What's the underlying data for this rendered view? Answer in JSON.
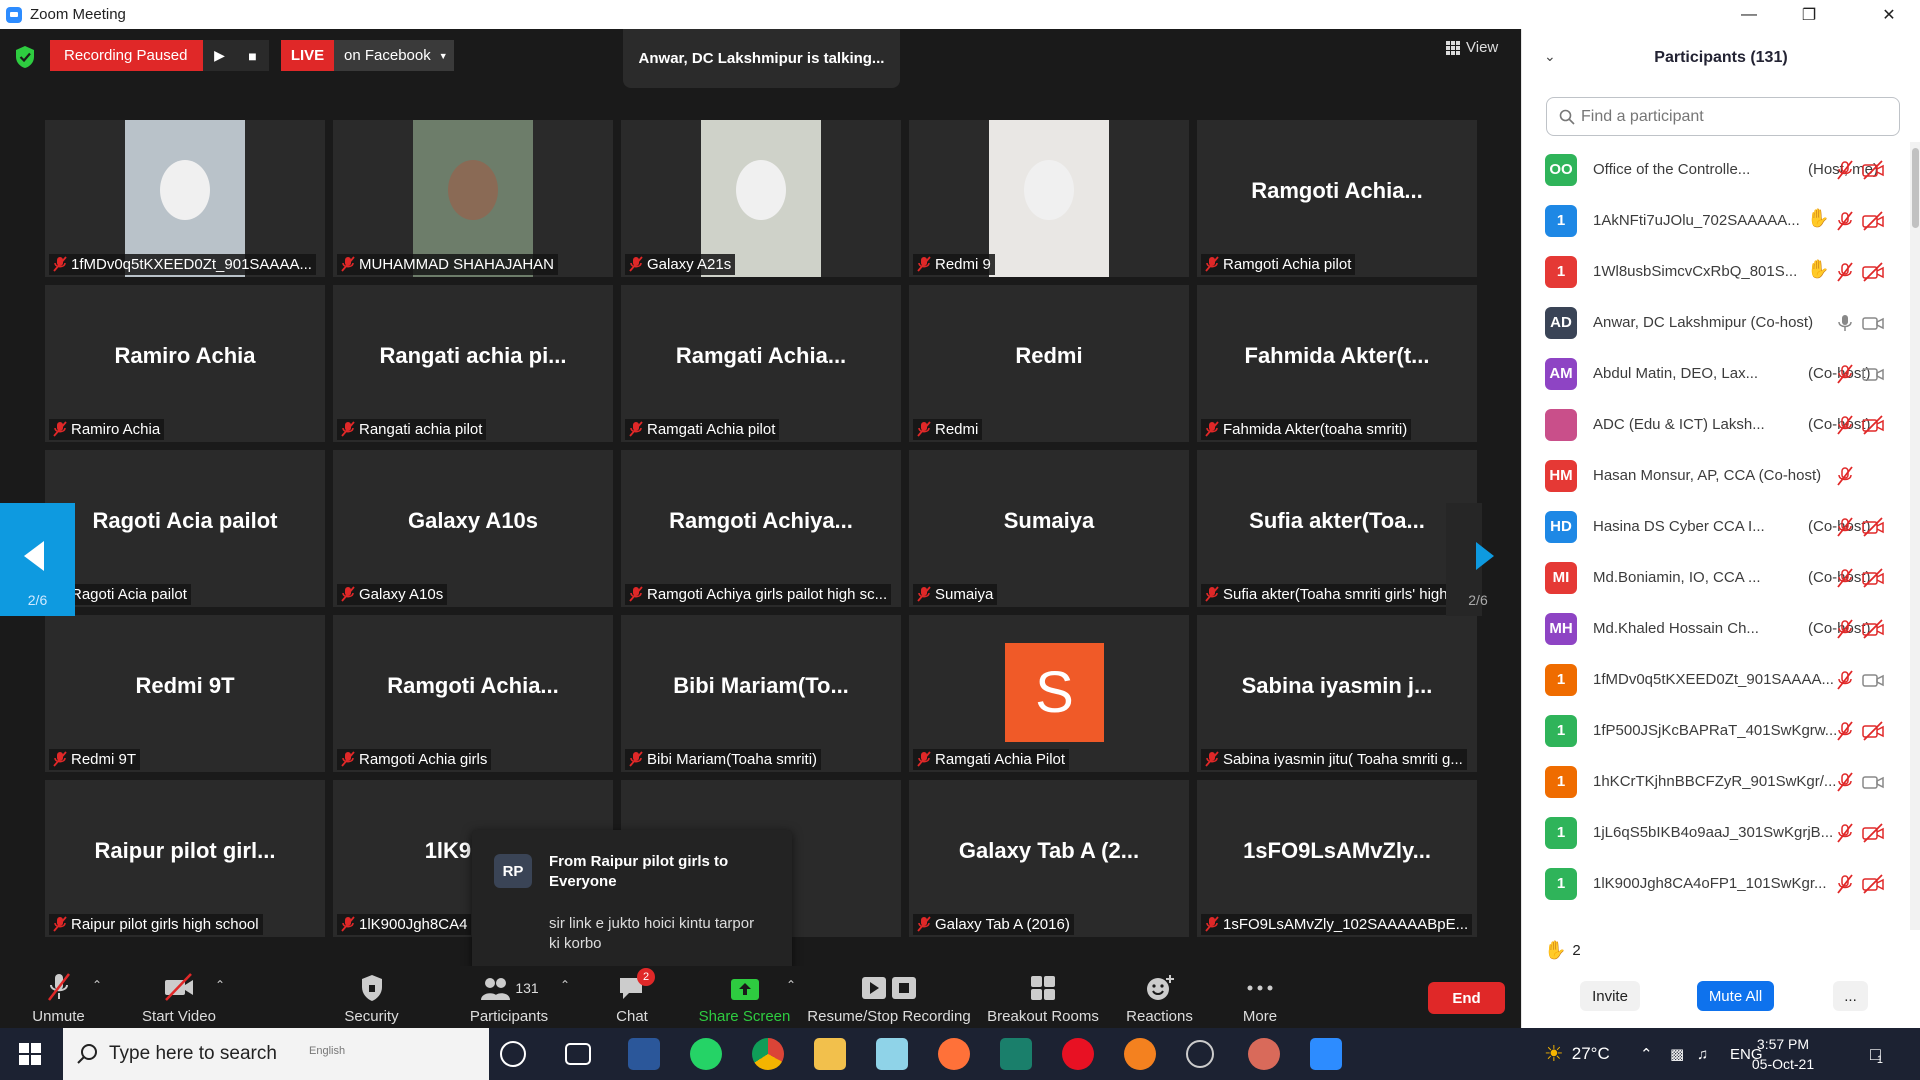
{
  "window": {
    "title": "Zoom Meeting"
  },
  "topbar": {
    "recording_label": "Recording Paused",
    "live_label": "LIVE",
    "live_target": "on Facebook",
    "talking_text": "Anwar, DC Lakshmipur is talking...",
    "view_label": "View"
  },
  "pager": {
    "left_page": "2/6",
    "right_page": "2/6"
  },
  "tiles": [
    {
      "big": "",
      "label": "1fMDv0q5tKXEED0Zt_901SAAAA..."
    },
    {
      "big": "",
      "label": "MUHAMMAD SHAHAJAHAN"
    },
    {
      "big": "",
      "label": "Galaxy A21s"
    },
    {
      "big": "",
      "label": "Redmi 9"
    },
    {
      "big": "Ramgoti  Achia...",
      "label": "Ramgoti Achia pilot"
    },
    {
      "big": "Ramiro Achia",
      "label": "Ramiro Achia"
    },
    {
      "big": "Rangati  achia  pi...",
      "label": "Rangati achia pilot"
    },
    {
      "big": "Ramgati   Achia...",
      "label": "Ramgati  Achia pilot"
    },
    {
      "big": "Redmi",
      "label": "Redmi"
    },
    {
      "big": "Fahmida  Akter(t...",
      "label": "Fahmida Akter(toaha smriti)"
    },
    {
      "big": "Ragoti Acia pailot",
      "label": "Ragoti Acia pailot"
    },
    {
      "big": "Galaxy A10s",
      "label": "Galaxy A10s"
    },
    {
      "big": "Ramgoti  Achiya...",
      "label": "Ramgoti Achiya girls pailot high sc..."
    },
    {
      "big": "Sumaiya",
      "label": "Sumaiya"
    },
    {
      "big": "Sufia  akter(Toa...",
      "label": "Sufia akter(Toaha smriti girls' high..."
    },
    {
      "big": "Redmi 9T",
      "label": "Redmi 9T"
    },
    {
      "big": "Ramgoti  Achia...",
      "label": "Ramgoti Achia girls"
    },
    {
      "big": "Bibi  Mariam(To...",
      "label": "Bibi Mariam(Toaha smriti)"
    },
    {
      "big": "S",
      "label": "Ramgati Achia Pilot"
    },
    {
      "big": "Sabina  iyasmin  j...",
      "label": "Sabina iyasmin jitu( Toaha smriti g..."
    },
    {
      "big": "Raipur  pilot  girl...",
      "label": "Raipur pilot girls high school"
    },
    {
      "big": "1lK900Jg",
      "label": "1lK900Jgh8CA4"
    },
    {
      "big": "chia...",
      "label": ""
    },
    {
      "big": "Galaxy  Tab  A  (2...",
      "label": "Galaxy Tab A (2016)"
    },
    {
      "big": "1sFO9LsAMvZly...",
      "label": "1sFO9LsAMvZly_102SAAAAABpE..."
    }
  ],
  "chat_popup": {
    "avatar": "RP",
    "from": "From Raipur pilot girls to Everyone",
    "message": "sir link e jukto hoici kintu tarpor ki korbo"
  },
  "toolbar": {
    "unmute": "Unmute",
    "start_video": "Start Video",
    "security": "Security",
    "participants": "Participants",
    "participants_count": "131",
    "chat": "Chat",
    "chat_badge": "2",
    "share_screen": "Share Screen",
    "recording": "Resume/Stop Recording",
    "breakout": "Breakout Rooms",
    "reactions": "Reactions",
    "more": "More",
    "end": "End"
  },
  "panel": {
    "title": "Participants (131)",
    "search_placeholder": "Find a participant",
    "participants": [
      {
        "av": "OO",
        "color": "#2fb45a",
        "name": "Office of the Controlle...",
        "role": "(Host, me)",
        "mic": "muted",
        "cam": "off"
      },
      {
        "av": "1",
        "color": "#1e88e5",
        "name": "1AkNFti7uJOlu_702SAAAAA...",
        "role": "",
        "hand": true,
        "mic": "muted",
        "cam": "off"
      },
      {
        "av": "1",
        "color": "#e53935",
        "name": "1Wl8usbSimcvCxRbQ_801S...",
        "role": "",
        "hand": true,
        "mic": "muted",
        "cam": "off"
      },
      {
        "av": "AD",
        "color": "#3a4456",
        "name": "Anwar, DC Lakshmipur (Co-host)",
        "role": "",
        "mic": "on",
        "cam": "on-gray"
      },
      {
        "av": "AM",
        "color": "#8e44c4",
        "name": "Abdul Matin, DEO, Lax...",
        "role": "(Co-host)",
        "mic": "muted",
        "cam": "on-gray"
      },
      {
        "av": "",
        "color": "#c94f8a",
        "name": "ADC (Edu & ICT) Laksh...",
        "role": "(Co-host)",
        "mic": "muted",
        "cam": "off"
      },
      {
        "av": "HM",
        "color": "#e53935",
        "name": "Hasan Monsur, AP, CCA (Co-host)",
        "role": "",
        "mic": "muted",
        "cam": ""
      },
      {
        "av": "HD",
        "color": "#1e88e5",
        "name": "Hasina DS Cyber CCA I...",
        "role": "(Co-host)",
        "mic": "muted",
        "cam": "off"
      },
      {
        "av": "MI",
        "color": "#e53935",
        "name": "Md.Boniamin, IO, CCA ...",
        "role": "(Co-host)",
        "mic": "muted",
        "cam": "off"
      },
      {
        "av": "MH",
        "color": "#8e44c4",
        "name": "Md.Khaled Hossain Ch...",
        "role": "(Co-host)",
        "mic": "muted",
        "cam": "off"
      },
      {
        "av": "1",
        "color": "#ef6c00",
        "name": "1fMDv0q5tKXEED0Zt_901SAAAA...",
        "role": "",
        "mic": "muted",
        "cam": "on-gray"
      },
      {
        "av": "1",
        "color": "#2fb45a",
        "name": "1fP500JSjKcBAPRaT_401SwKgrw...",
        "role": "",
        "mic": "muted",
        "cam": "off"
      },
      {
        "av": "1",
        "color": "#ef6c00",
        "name": "1hKCrTKjhnBBCFZyR_901SwKgr/...",
        "role": "",
        "mic": "muted",
        "cam": "on-gray"
      },
      {
        "av": "1",
        "color": "#2fb45a",
        "name": "1jL6qS5bIKB4o9aaJ_301SwKgrjB...",
        "role": "",
        "mic": "muted",
        "cam": "off"
      },
      {
        "av": "1",
        "color": "#2fb45a",
        "name": "1lK900Jgh8CA4oFP1_101SwKgr...",
        "role": "",
        "mic": "muted",
        "cam": "off"
      }
    ],
    "hands_count": "2",
    "invite": "Invite",
    "mute_all": "Mute All",
    "more": "..."
  },
  "taskbar": {
    "search_placeholder": "Type here to search",
    "search_overlay": "English",
    "weather": "27°C",
    "language": "ENG",
    "time": "3:57 PM",
    "date": "05-Oct-21",
    "notifications": "1"
  }
}
